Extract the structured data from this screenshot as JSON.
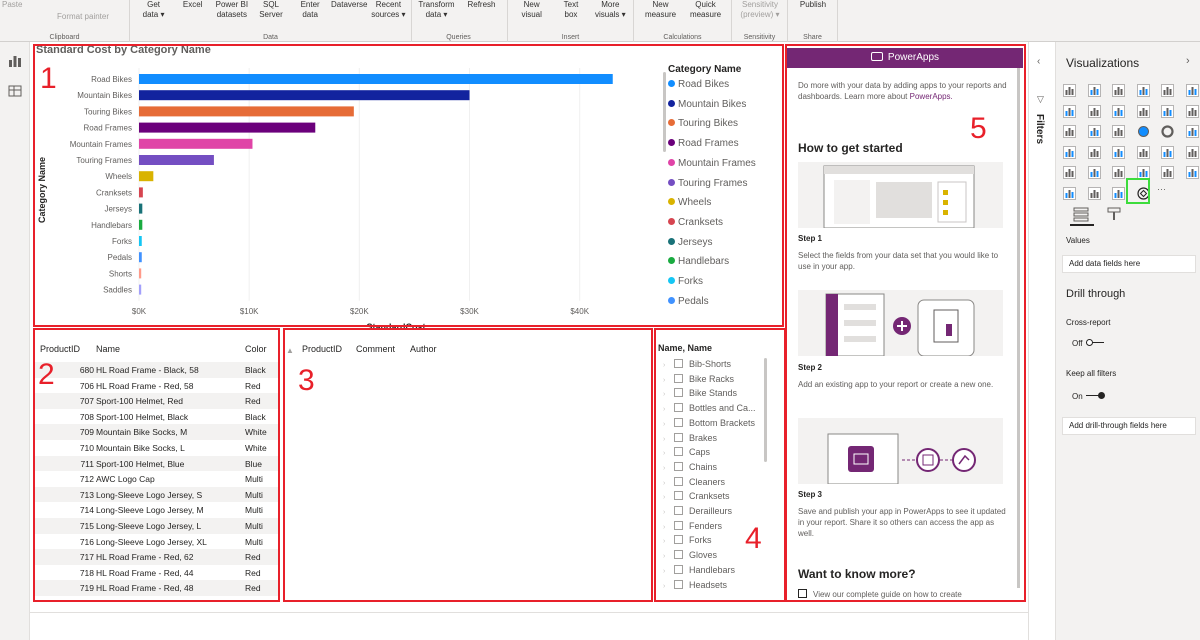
{
  "ribbon": {
    "groups": [
      {
        "title": "Clipboard",
        "buttons": [
          {
            "label": "Paste",
            "disabled": true
          },
          {
            "label": "Format painter",
            "disabled": true
          }
        ]
      },
      {
        "title": "Data",
        "buttons": [
          {
            "label": "Get\ndata ▾"
          },
          {
            "label": "Excel"
          },
          {
            "label": "Power BI\ndatasets"
          },
          {
            "label": "SQL\nServer"
          },
          {
            "label": "Enter\ndata"
          },
          {
            "label": "Dataverse"
          },
          {
            "label": "Recent\nsources ▾"
          }
        ]
      },
      {
        "title": "Queries",
        "buttons": [
          {
            "label": "Transform\ndata ▾"
          },
          {
            "label": "Refresh"
          }
        ]
      },
      {
        "title": "Insert",
        "buttons": [
          {
            "label": "New\nvisual"
          },
          {
            "label": "Text\nbox"
          },
          {
            "label": "More\nvisuals ▾"
          }
        ]
      },
      {
        "title": "Calculations",
        "buttons": [
          {
            "label": "New\nmeasure"
          },
          {
            "label": "Quick\nmeasure"
          }
        ]
      },
      {
        "title": "Sensitivity",
        "buttons": [
          {
            "label": "Sensitivity\n(preview) ▾",
            "disabled": true
          }
        ]
      },
      {
        "title": "Share",
        "buttons": [
          {
            "label": "Publish"
          }
        ]
      }
    ]
  },
  "chart": {
    "number": "1",
    "title": "Standard Cost by Category Name",
    "legend_title": "Category Name",
    "legend": [
      {
        "name": "Road Bikes",
        "color": "#118dff"
      },
      {
        "name": "Mountain Bikes",
        "color": "#12239e"
      },
      {
        "name": "Touring Bikes",
        "color": "#e66c37"
      },
      {
        "name": "Road Frames",
        "color": "#6b007b"
      },
      {
        "name": "Mountain Frames",
        "color": "#e044a7"
      },
      {
        "name": "Touring Frames",
        "color": "#744ec2"
      },
      {
        "name": "Wheels",
        "color": "#d9b300"
      },
      {
        "name": "Cranksets",
        "color": "#d64550"
      },
      {
        "name": "Jerseys",
        "color": "#197278"
      },
      {
        "name": "Handlebars",
        "color": "#1aab40"
      },
      {
        "name": "Forks",
        "color": "#15c6f4"
      },
      {
        "name": "Pedals",
        "color": "#4092ff"
      }
    ]
  },
  "chart_data": {
    "type": "bar",
    "orientation": "horizontal",
    "title": "Standard Cost by Category Name",
    "xlabel": "StandardCost",
    "ylabel": "Category Name",
    "categories": [
      "Road Bikes",
      "Mountain Bikes",
      "Touring Bikes",
      "Road Frames",
      "Mountain Frames",
      "Touring Frames",
      "Wheels",
      "Cranksets",
      "Jerseys",
      "Handlebars",
      "Forks",
      "Pedals",
      "Shorts",
      "Saddles"
    ],
    "values": [
      43000,
      30000,
      19500,
      16000,
      10300,
      6800,
      1300,
      350,
      300,
      300,
      250,
      250,
      200,
      200
    ],
    "colors": [
      "#118dff",
      "#12239e",
      "#e66c37",
      "#6b007b",
      "#e044a7",
      "#744ec2",
      "#d9b300",
      "#d64550",
      "#197278",
      "#1aab40",
      "#15c6f4",
      "#4092ff",
      "#ff9b8a",
      "#a3a0fb"
    ],
    "xticks": [
      "$0K",
      "$10K",
      "$20K",
      "$30K",
      "$40K"
    ],
    "xtick_values": [
      0,
      10000,
      20000,
      30000,
      40000
    ],
    "xlim": [
      0,
      44000
    ],
    "legend_position": "right"
  },
  "table": {
    "number": "2",
    "columns": [
      "ProductID",
      "Name",
      "Color"
    ],
    "rows": [
      [
        "680",
        "HL Road Frame - Black, 58",
        "Black"
      ],
      [
        "706",
        "HL Road Frame - Red, 58",
        "Red"
      ],
      [
        "707",
        "Sport-100 Helmet, Red",
        "Red"
      ],
      [
        "708",
        "Sport-100 Helmet, Black",
        "Black"
      ],
      [
        "709",
        "Mountain Bike Socks, M",
        "White"
      ],
      [
        "710",
        "Mountain Bike Socks, L",
        "White"
      ],
      [
        "711",
        "Sport-100 Helmet, Blue",
        "Blue"
      ],
      [
        "712",
        "AWC Logo Cap",
        "Multi"
      ],
      [
        "713",
        "Long-Sleeve Logo Jersey, S",
        "Multi"
      ],
      [
        "714",
        "Long-Sleeve Logo Jersey, M",
        "Multi"
      ],
      [
        "715",
        "Long-Sleeve Logo Jersey, L",
        "Multi"
      ],
      [
        "716",
        "Long-Sleeve Logo Jersey, XL",
        "Multi"
      ],
      [
        "717",
        "HL Road Frame - Red, 62",
        "Red"
      ],
      [
        "718",
        "HL Road Frame - Red, 44",
        "Red"
      ],
      [
        "719",
        "HL Road Frame - Red, 48",
        "Red"
      ]
    ]
  },
  "comments": {
    "number": "3",
    "columns": [
      "ProductID",
      "Comment",
      "Author"
    ]
  },
  "slicer": {
    "number": "4",
    "title": "Name, Name",
    "items": [
      "Bib-Shorts",
      "Bike Racks",
      "Bike Stands",
      "Bottles and Ca...",
      "Bottom Brackets",
      "Brakes",
      "Caps",
      "Chains",
      "Cleaners",
      "Cranksets",
      "Derailleurs",
      "Fenders",
      "Forks",
      "Gloves",
      "Handlebars",
      "Headsets"
    ]
  },
  "powerapps": {
    "number": "5",
    "header": "PowerApps",
    "intro": "Do more with your data by adding apps to your reports and dashboards. Learn more about",
    "intro_link": "PowerApps.",
    "how_title": "How to get started",
    "step1_title": "Step 1",
    "step1_text": "Select the fields from your data set that you would like to use in your app.",
    "step2_title": "Step 2",
    "step2_text": "Add an existing app to your report or create a new one.",
    "step3_title": "Step 3",
    "step3_text": "Save and publish your app in PowerApps to see it updated in your report. Share it so others can access the app as well.",
    "more_title": "Want to know more?",
    "more_text": "View our complete guide on how to create"
  },
  "filters": {
    "label": "Filters"
  },
  "visualizations": {
    "title": "Visualizations",
    "values_label": "Values",
    "add_fields": "Add data fields here",
    "drill_title": "Drill through",
    "cross_report": "Cross-report",
    "cross_state": "Off",
    "keep_filters": "Keep all filters",
    "keep_state": "On",
    "add_drill": "Add drill-through fields here",
    "more": "···",
    "highlight_color": "#3cdc3c"
  }
}
